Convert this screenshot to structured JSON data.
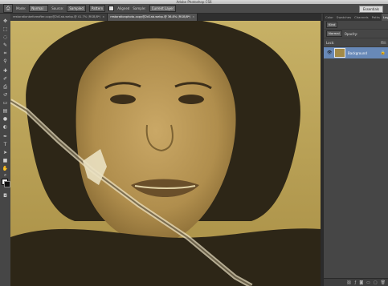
{
  "window": {
    "title": "Adobe Photoshop CS6"
  },
  "options_bar": {
    "mode_label": "Mode:",
    "mode_value": "Normal",
    "source_label": "Source:",
    "sampled_button": "Sampled",
    "pattern_button": "Pattern",
    "aligned_label": "Aligned",
    "sample_label": "Sample:",
    "sample_value": "Current Layer",
    "workspace_button": "Essentials"
  },
  "document_tabs": [
    {
      "label": "restorationbeforeafter.copy@2d1ab.webp.@ 41.7% (RGB/8*)",
      "active": false
    },
    {
      "label": "restorationphoto-copy@2d1ab.webp.@ 36.8% (RGB/8*)",
      "active": true
    }
  ],
  "panel": {
    "tabs": [
      "Color",
      "Swatches",
      "Channels",
      "Paths",
      "Layers"
    ],
    "active_tab": "Layers",
    "kind_filter": "Kind",
    "blend_mode": "Normal",
    "opacity_label": "Opacity:",
    "lock_label": "Lock:",
    "fill_label": "Fill:",
    "layer_name": "Background"
  },
  "colors": {
    "photo_tone": "#b59c4f",
    "selected_layer": "#6889b8"
  },
  "icons": [
    "move-icon",
    "marquee-icon",
    "lasso-icon",
    "quick-select-icon",
    "crop-icon",
    "eyedropper-icon",
    "healing-icon",
    "brush-icon",
    "clone-stamp-icon",
    "history-brush-icon",
    "eraser-icon",
    "gradient-icon",
    "blur-icon",
    "dodge-icon",
    "pen-icon",
    "type-icon",
    "path-select-icon",
    "shape-icon",
    "hand-icon",
    "zoom-icon"
  ]
}
